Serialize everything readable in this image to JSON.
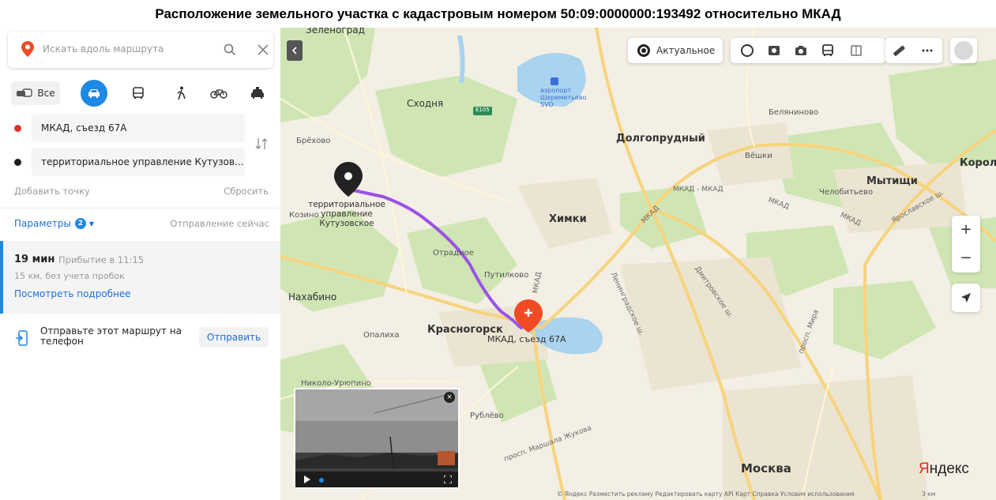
{
  "page_title": "Расположение земельного участка с кадастровым номером 50:09:0000000:193492 относительно МКАД",
  "sidebar": {
    "search_placeholder": "Искать вдоль маршрута",
    "modes": {
      "all_label": "Все"
    },
    "point_a": "МКАД, съезд 67А",
    "point_b": "территориальное управление Кутузов...",
    "add_point": "Добавить точку",
    "reset": "Сбросить",
    "params_label": "Параметры",
    "params_count": "2",
    "depart": "Отправление сейчас",
    "route": {
      "time": "19 мин",
      "arrival": "Прибытие в 11:15",
      "distance": "15 км, без учета пробок",
      "details": "Посмотреть подробнее"
    },
    "send_text": "Отправьте этот маршрут на телефон",
    "send_button": "Отправить"
  },
  "map": {
    "toolbar": {
      "actual_label": "Актуальное"
    },
    "zoom_in": "+",
    "zoom_out": "−",
    "cities": {
      "zelenograd": "Зеленоград",
      "skhodnya": "Сходня",
      "dolgoprudny": "Долгопрудный",
      "khimki": "Химки",
      "mytishchi": "Мытищи",
      "korolev": "Королё",
      "nakhabino": "Нахабино",
      "krasnogorsk": "Красногорск",
      "moskva": "Москва"
    },
    "places": {
      "brekhovo": "Брёхово",
      "kozino": "Козино",
      "otradnoe": "Отрадное",
      "putilkovo": "Путилково",
      "opalikha": "Опалиха",
      "nikolo_uryupino": "Николо-Урюпино",
      "rublevo": "Рублёво",
      "belyaninovo": "Беляниново",
      "veshki": "Вёшки",
      "chelobitevo": "Челобитьево",
      "airport": "аэропорт Шереметьево SVO",
      "e105": "E105"
    },
    "roads": {
      "mkad1": "МКАД - МКАД",
      "mkad2": "МКАД",
      "mkad3": "МКАД",
      "mkad4": "МКАД",
      "mkad5": "МКАД",
      "yaroslavskoe": "Ярославское ш.",
      "dmitrovskoe": "Дмитровское ш.",
      "leningradskoe": "Ленинградское ш.",
      "prosp_mira": "просп. Мира",
      "marshala": "просп. Маршала Жукова"
    },
    "destination_label": "территориальное управление Кутузовское",
    "origin_label": "МКАД, съезд 67А",
    "logo_y": "Я",
    "logo_rest": "ндекс",
    "copyright": "© Яндекс   Разместить рекламу   Редактировать карту   API Карт   Справка   Условия использования",
    "scale": "3 км"
  },
  "colors": {
    "route": "#9b52e6",
    "accent": "#1e88e5",
    "origin_pin": "#f04b24",
    "dest_pin": "#222222"
  }
}
